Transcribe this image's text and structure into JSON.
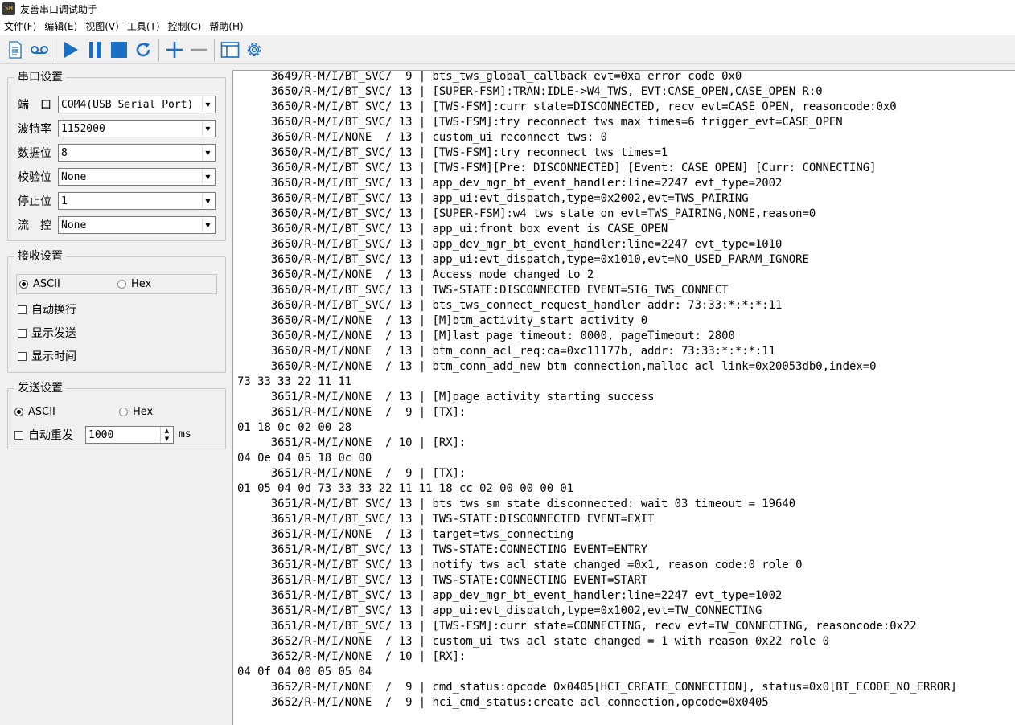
{
  "window": {
    "title": "友善串口调试助手",
    "icon_label": "SH"
  },
  "menu": [
    {
      "label": "文件(F)"
    },
    {
      "label": "编辑(E)"
    },
    {
      "label": "视图(V)"
    },
    {
      "label": "工具(T)"
    },
    {
      "label": "控制(C)"
    },
    {
      "label": "帮助(H)"
    }
  ],
  "toolbar": {
    "icons": [
      "document-icon",
      "record-icon",
      "play-icon",
      "pause-icon",
      "stop-icon",
      "refresh-icon",
      "add-icon",
      "remove-icon",
      "window-icon",
      "gear-icon"
    ],
    "accent_color": "#1a6fc4"
  },
  "serial_settings": {
    "title": "串口设置",
    "port": {
      "label": "端　口",
      "value": "COM4(USB Serial Port)"
    },
    "baud": {
      "label": "波特率",
      "value": "1152000"
    },
    "data_bits": {
      "label": "数据位",
      "value": "8"
    },
    "parity": {
      "label": "校验位",
      "value": "None"
    },
    "stop_bits": {
      "label": "停止位",
      "value": "1"
    },
    "flow": {
      "label": "流　控",
      "value": "None"
    }
  },
  "receive_settings": {
    "title": "接收设置",
    "ascii_label": "ASCII",
    "hex_label": "Hex",
    "selected": "ASCII",
    "auto_wrap": "自动换行",
    "show_send": "显示发送",
    "show_time": "显示时间"
  },
  "send_settings": {
    "title": "发送设置",
    "ascii_label": "ASCII",
    "hex_label": "Hex",
    "selected": "ASCII",
    "auto_resend": "自动重发",
    "interval": "1000",
    "unit": "ms"
  },
  "log_lines": [
    "     3649/R-M/I/BT_SVC/  9 | bts_tws_global_callback evt=0xa error code 0x0",
    "     3650/R-M/I/BT_SVC/ 13 | [SUPER-FSM]:TRAN:IDLE->W4_TWS, EVT:CASE_OPEN,CASE_OPEN R:0",
    "     3650/R-M/I/BT_SVC/ 13 | [TWS-FSM]:curr state=DISCONNECTED, recv evt=CASE_OPEN, reasoncode:0x0",
    "     3650/R-M/I/BT_SVC/ 13 | [TWS-FSM]:try reconnect tws max times=6 trigger_evt=CASE_OPEN",
    "     3650/R-M/I/NONE  / 13 | custom_ui reconnect tws: 0",
    "     3650/R-M/I/BT_SVC/ 13 | [TWS-FSM]:try reconnect tws times=1",
    "     3650/R-M/I/BT_SVC/ 13 | [TWS-FSM][Pre: DISCONNECTED] [Event: CASE_OPEN] [Curr: CONNECTING]",
    "     3650/R-M/I/BT_SVC/ 13 | app_dev_mgr_bt_event_handler:line=2247 evt_type=2002",
    "     3650/R-M/I/BT_SVC/ 13 | app_ui:evt_dispatch,type=0x2002,evt=TWS_PAIRING",
    "     3650/R-M/I/BT_SVC/ 13 | [SUPER-FSM]:w4 tws state on evt=TWS_PAIRING,NONE,reason=0",
    "     3650/R-M/I/BT_SVC/ 13 | app_ui:front box event is CASE_OPEN",
    "     3650/R-M/I/BT_SVC/ 13 | app_dev_mgr_bt_event_handler:line=2247 evt_type=1010",
    "     3650/R-M/I/BT_SVC/ 13 | app_ui:evt_dispatch,type=0x1010,evt=NO_USED_PARAM_IGNORE",
    "     3650/R-M/I/NONE  / 13 | Access mode changed to 2",
    "     3650/R-M/I/BT_SVC/ 13 | TWS-STATE:DISCONNECTED EVENT=SIG_TWS_CONNECT",
    "     3650/R-M/I/BT_SVC/ 13 | bts_tws_connect_request_handler addr: 73:33:*:*:*:11",
    "     3650/R-M/I/NONE  / 13 | [M]btm_activity_start activity 0",
    "     3650/R-M/I/NONE  / 13 | [M]last_page_timeout: 0000, pageTimeout: 2800",
    "     3650/R-M/I/NONE  / 13 | btm_conn_acl_req:ca=0xc11177b, addr: 73:33:*:*:*:11",
    "     3650/R-M/I/NONE  / 13 | btm_conn_add_new btm connection,malloc acl link=0x20053db0,index=0",
    "73 33 33 22 11 11",
    "     3651/R-M/I/NONE  / 13 | [M]page activity starting success",
    "     3651/R-M/I/NONE  /  9 | [TX]:",
    "01 18 0c 02 00 28",
    "     3651/R-M/I/NONE  / 10 | [RX]:",
    "04 0e 04 05 18 0c 00",
    "     3651/R-M/I/NONE  /  9 | [TX]:",
    "01 05 04 0d 73 33 33 22 11 11 18 cc 02 00 00 00 01",
    "     3651/R-M/I/BT_SVC/ 13 | bts_tws_sm_state_disconnected: wait 03 timeout = 19640",
    "     3651/R-M/I/BT_SVC/ 13 | TWS-STATE:DISCONNECTED EVENT=EXIT",
    "     3651/R-M/I/NONE  / 13 | target=tws_connecting",
    "     3651/R-M/I/BT_SVC/ 13 | TWS-STATE:CONNECTING EVENT=ENTRY",
    "     3651/R-M/I/BT_SVC/ 13 | notify tws acl state changed =0x1, reason code:0 role 0",
    "     3651/R-M/I/BT_SVC/ 13 | TWS-STATE:CONNECTING EVENT=START",
    "     3651/R-M/I/BT_SVC/ 13 | app_dev_mgr_bt_event_handler:line=2247 evt_type=1002",
    "     3651/R-M/I/BT_SVC/ 13 | app_ui:evt_dispatch,type=0x1002,evt=TW_CONNECTING",
    "     3651/R-M/I/BT_SVC/ 13 | [TWS-FSM]:curr state=CONNECTING, recv evt=TW_CONNECTING, reasoncode:0x22",
    "     3652/R-M/I/NONE  / 13 | custom_ui tws acl state changed = 1 with reason 0x22 role 0",
    "     3652/R-M/I/NONE  / 10 | [RX]:",
    "04 0f 04 00 05 05 04",
    "     3652/R-M/I/NONE  /  9 | cmd_status:opcode 0x0405[HCI_CREATE_CONNECTION], status=0x0[BT_ECODE_NO_ERROR]",
    "     3652/R-M/I/NONE  /  9 | hci_cmd_status:create acl connection,opcode=0x0405"
  ]
}
